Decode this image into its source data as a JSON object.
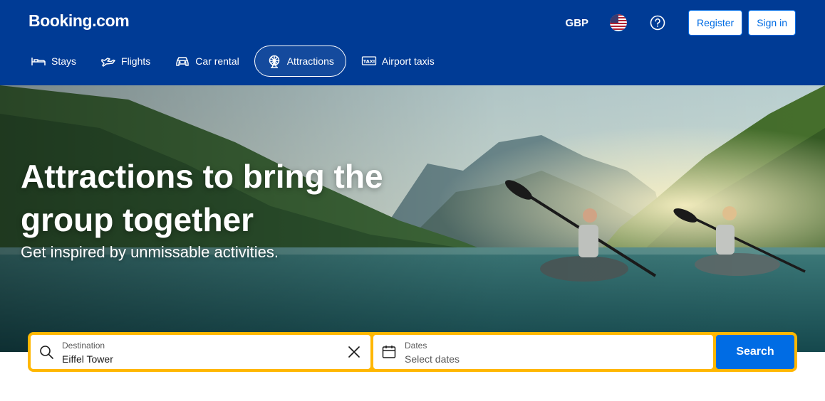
{
  "header": {
    "logo": "Booking.com",
    "currency": "GBP",
    "register_label": "Register",
    "signin_label": "Sign in"
  },
  "nav": {
    "items": [
      {
        "label": "Stays",
        "icon": "bed-icon"
      },
      {
        "label": "Flights",
        "icon": "plane-icon"
      },
      {
        "label": "Car rental",
        "icon": "car-icon"
      },
      {
        "label": "Attractions",
        "icon": "ferris-wheel-icon",
        "active": true
      },
      {
        "label": "Airport taxis",
        "icon": "taxi-icon"
      }
    ]
  },
  "hero": {
    "title": "Attractions to bring the group together",
    "subtitle": "Get inspired by unmissable activities."
  },
  "search": {
    "destination_label": "Destination",
    "destination_value": "Eiffel Tower",
    "dates_label": "Dates",
    "dates_placeholder": "Select dates",
    "button_label": "Search"
  },
  "colors": {
    "brand": "#003b95",
    "accent": "#006ce4",
    "search_border": "#ffb700"
  }
}
